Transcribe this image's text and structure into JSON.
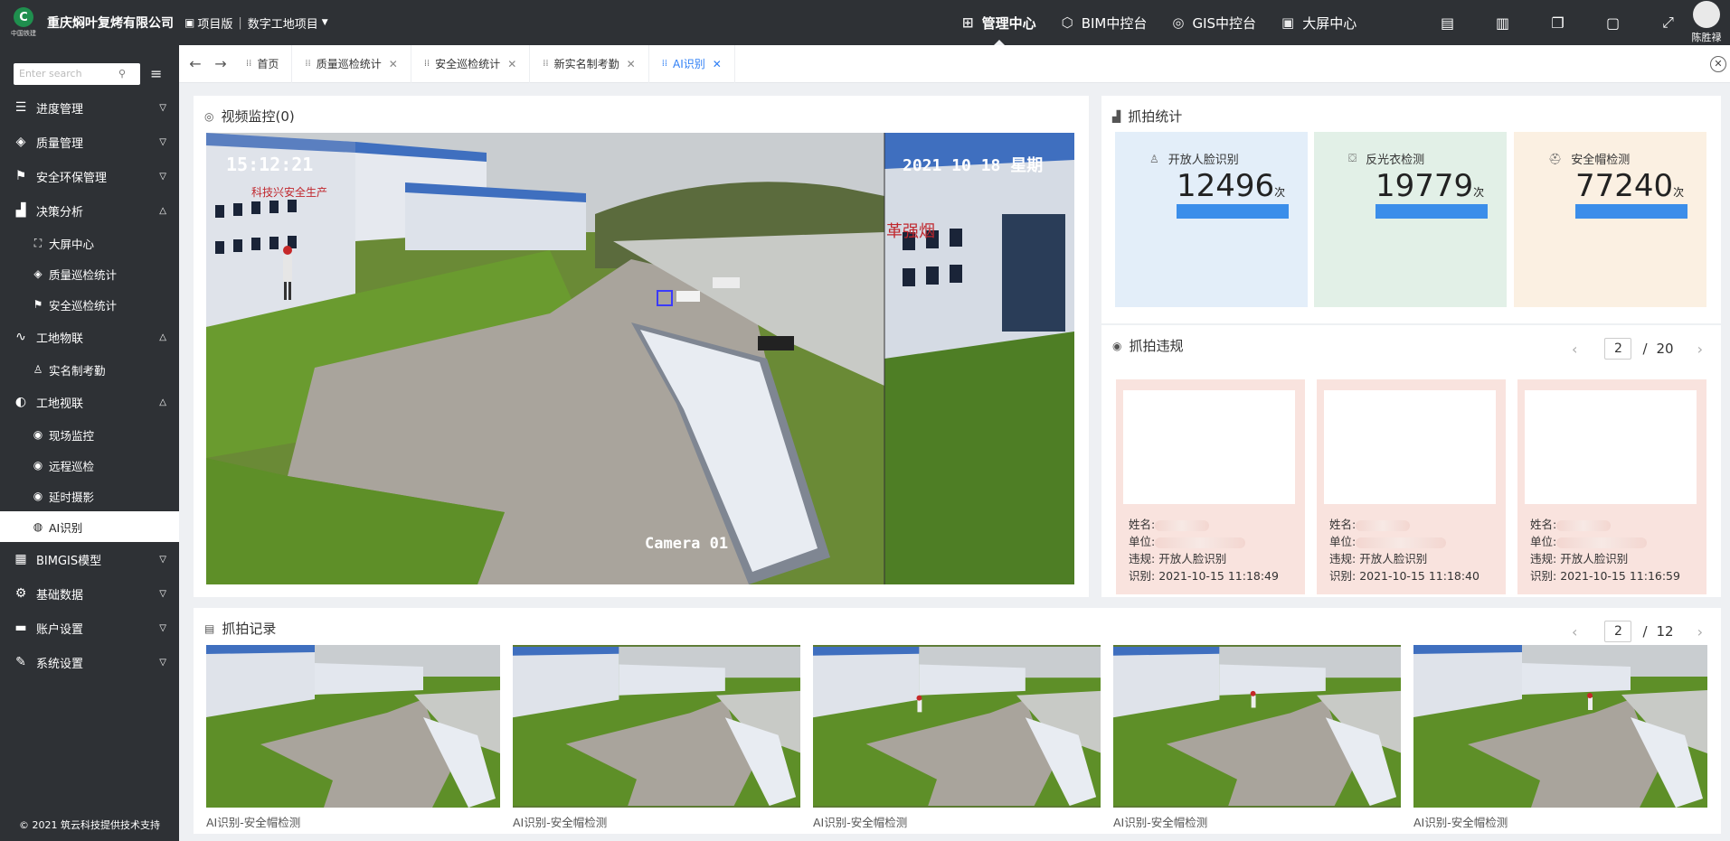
{
  "header": {
    "logo_text": "中国铁建",
    "company": "重庆焖叶复烤有限公司",
    "edition": "项目版",
    "project": "数字工地项目",
    "nav": [
      {
        "label": "管理中心",
        "icon": "grid-icon",
        "active": true
      },
      {
        "label": "BIM中控台",
        "icon": "cube-icon",
        "active": false
      },
      {
        "label": "GIS中控台",
        "icon": "globe-icon",
        "active": false
      },
      {
        "label": "大屏中心",
        "icon": "screen-icon",
        "active": false
      }
    ],
    "user_name": "陈胜禄"
  },
  "sidebar": {
    "search_placeholder": "Enter search",
    "menu": [
      {
        "label": "进度管理",
        "icon": "list-icon",
        "expanded": false
      },
      {
        "label": "质量管理",
        "icon": "badge-icon",
        "expanded": false
      },
      {
        "label": "安全环保管理",
        "icon": "flag-icon",
        "expanded": false
      },
      {
        "label": "决策分析",
        "icon": "bar-chart-icon",
        "expanded": true
      },
      {
        "label": "大屏中心",
        "icon": "expand-icon",
        "sub": true
      },
      {
        "label": "质量巡检统计",
        "icon": "badge-icon",
        "sub": true
      },
      {
        "label": "安全巡检统计",
        "icon": "flag-icon",
        "sub": true
      },
      {
        "label": "工地物联",
        "icon": "pulse-icon",
        "expanded": true
      },
      {
        "label": "实名制考勤",
        "icon": "user-icon",
        "sub": true
      },
      {
        "label": "工地视联",
        "icon": "contrast-icon",
        "expanded": true
      },
      {
        "label": "现场监控",
        "icon": "camera-icon",
        "sub": true
      },
      {
        "label": "远程巡检",
        "icon": "camera-icon",
        "sub": true
      },
      {
        "label": "延时摄影",
        "icon": "camera-icon",
        "sub": true
      },
      {
        "label": "AI识别",
        "icon": "ai-icon",
        "sub": true,
        "active": true
      },
      {
        "label": "BIMGIS模型",
        "icon": "grid-icon",
        "expanded": false
      },
      {
        "label": "基础数据",
        "icon": "gear-icon",
        "expanded": false
      },
      {
        "label": "账户设置",
        "icon": "briefcase-icon",
        "expanded": false
      },
      {
        "label": "系统设置",
        "icon": "pencil-icon",
        "expanded": false
      }
    ],
    "copyright": "© 2021 筑云科技提供技术支持"
  },
  "tabs": [
    {
      "label": "首页",
      "closable": false,
      "active": false
    },
    {
      "label": "质量巡检统计",
      "closable": true,
      "active": false
    },
    {
      "label": "安全巡检统计",
      "closable": true,
      "active": false
    },
    {
      "label": "新实名制考勤",
      "closable": true,
      "active": false
    },
    {
      "label": "AI识别",
      "closable": true,
      "active": true
    }
  ],
  "video": {
    "title": "视频监控(0)",
    "left_time": "15:12:21",
    "right_date": "2021 10 18 星期",
    "camera_label": "Camera 01",
    "banner_left": "科技兴安全生产",
    "banner_right": "革强烟"
  },
  "stats": {
    "title": "抓拍统计",
    "unit": "次",
    "cards": [
      {
        "label": "开放人脸识别",
        "value": "12496",
        "bg": "#e3eef9",
        "icon": "face-icon",
        "level": 1.0
      },
      {
        "label": "反光衣检测",
        "value": "19779",
        "bg": "#e2f0e7",
        "icon": "vest-icon",
        "level": 1.0
      },
      {
        "label": "安全帽检测",
        "value": "77240",
        "bg": "#fbf0e2",
        "icon": "helmet-icon",
        "level": 1.0
      }
    ]
  },
  "violations": {
    "title": "抓拍违规",
    "page": "2",
    "total_pages": "20",
    "name_label": "姓名:",
    "unit_label": "单位:",
    "violation_label": "违规:",
    "time_label": "识别:",
    "items": [
      {
        "violation": "开放人脸识别",
        "time": "2021-10-15 11:18:49"
      },
      {
        "violation": "开放人脸识别",
        "time": "2021-10-15 11:18:40"
      },
      {
        "violation": "开放人脸识别",
        "time": "2021-10-15 11:16:59"
      }
    ]
  },
  "records": {
    "title": "抓拍记录",
    "page": "2",
    "total_pages": "12",
    "items": [
      {
        "caption": "AI识别-安全帽检测"
      },
      {
        "caption": "AI识别-安全帽检测"
      },
      {
        "caption": "AI识别-安全帽检测"
      },
      {
        "caption": "AI识别-安全帽检测"
      },
      {
        "caption": "AI识别-安全帽检测"
      }
    ]
  }
}
